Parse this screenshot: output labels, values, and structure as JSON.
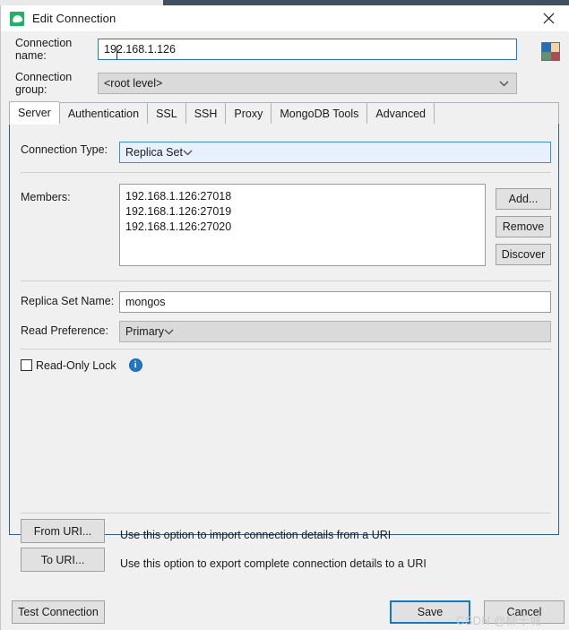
{
  "window": {
    "title": "Edit Connection",
    "app_icon": "mongo-leaf-icon",
    "close_icon": "close-icon"
  },
  "form": {
    "connection_name_label": "Connection name:",
    "connection_name_value": "192.168.1.126",
    "connection_group_label": "Connection group:",
    "connection_group_value": "<root level>",
    "color_swatch": {
      "name": "color-swatch-picker",
      "colors": [
        "#1f6fc0",
        "#f2d5a0",
        "#5a9470",
        "#b04a52"
      ]
    }
  },
  "tabs": [
    {
      "label": "Server",
      "active": true
    },
    {
      "label": "Authentication",
      "active": false
    },
    {
      "label": "SSL",
      "active": false
    },
    {
      "label": "SSH",
      "active": false
    },
    {
      "label": "Proxy",
      "active": false
    },
    {
      "label": "MongoDB Tools",
      "active": false
    },
    {
      "label": "Advanced",
      "active": false
    }
  ],
  "server": {
    "connection_type_label": "Connection Type:",
    "connection_type_value": "Replica Set",
    "members_label": "Members:",
    "members": [
      "192.168.1.126:27018",
      "192.168.1.126:27019",
      "192.168.1.126:27020"
    ],
    "member_buttons": [
      {
        "label": "Add...",
        "name": "add-member-button"
      },
      {
        "label": "Remove",
        "name": "remove-member-button"
      },
      {
        "label": "Discover",
        "name": "discover-members-button"
      }
    ],
    "replica_set_name_label": "Replica Set Name:",
    "replica_set_name_value": "mongos",
    "read_preference_label": "Read Preference:",
    "read_preference_value": "Primary",
    "read_only_lock_label": "Read-Only Lock",
    "read_only_lock_checked": false,
    "info_icon_glyph": "i"
  },
  "uri": {
    "from_label": "From URI...",
    "from_description": "Use this option to import connection details from a URI",
    "to_label": "To URI...",
    "to_description": "Use this option to export complete connection details to a URI"
  },
  "footer": {
    "test_label": "Test Connection",
    "save_label": "Save",
    "cancel_label": "Cancel"
  },
  "watermark": "CSDN @柳千城"
}
